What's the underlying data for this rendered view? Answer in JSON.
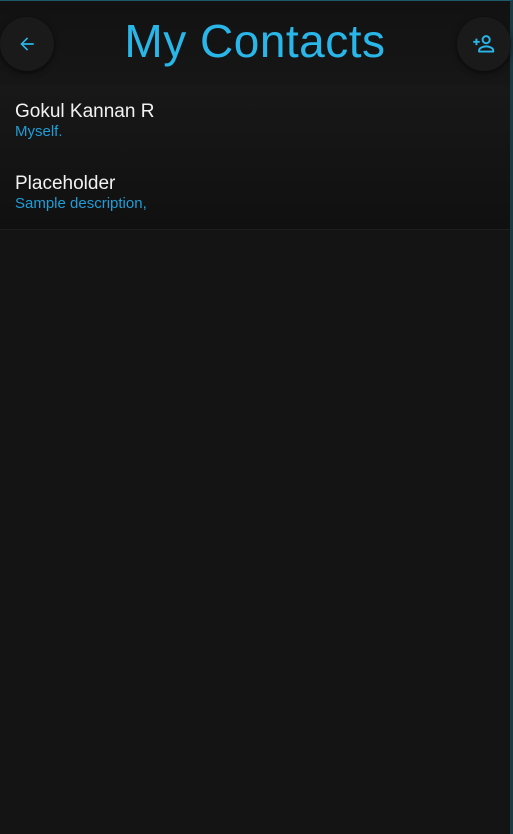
{
  "header": {
    "title": "My Contacts"
  },
  "colors": {
    "accent": "#29b6e8",
    "description": "#1e9ed8",
    "background": "#141414"
  },
  "icons": {
    "back": "arrow-left-icon",
    "add": "person-add-icon"
  },
  "contacts": [
    {
      "name": "Gokul Kannan R",
      "description": "Myself."
    },
    {
      "name": "Placeholder",
      "description": "Sample description,"
    }
  ]
}
